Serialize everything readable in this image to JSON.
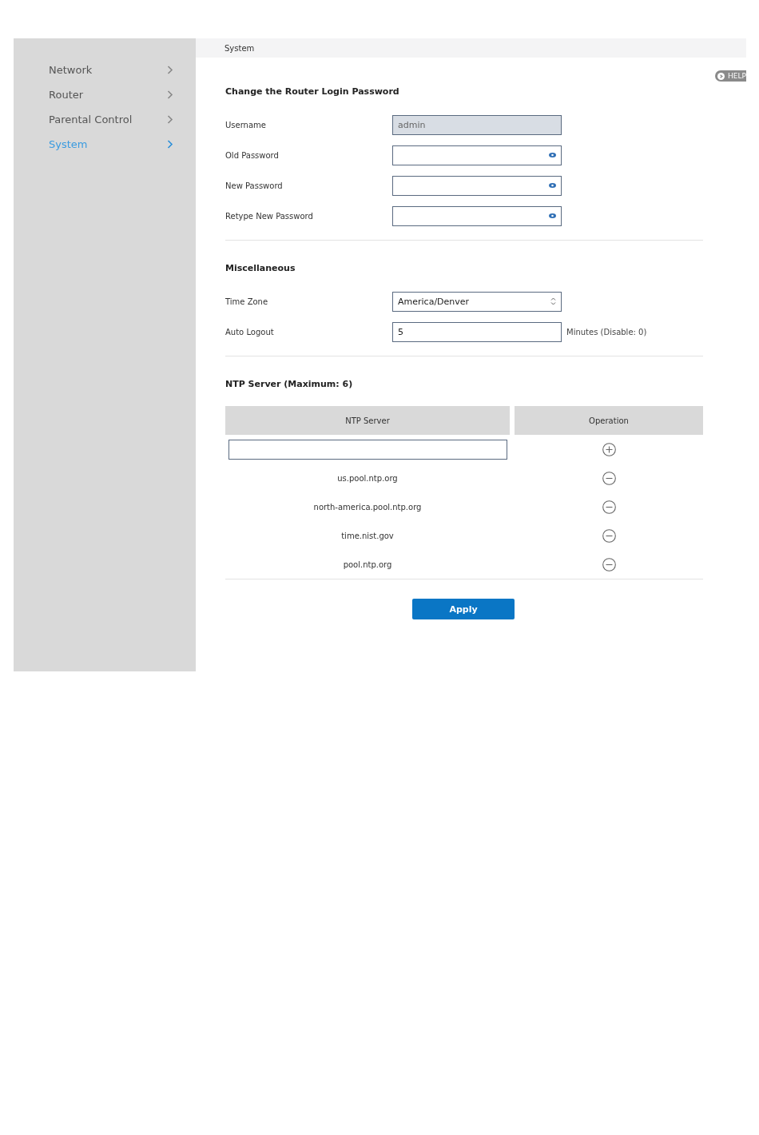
{
  "sidebar": {
    "items": [
      {
        "label": "Network",
        "selected": false
      },
      {
        "label": "Router",
        "selected": false
      },
      {
        "label": "Parental Control",
        "selected": false
      },
      {
        "label": "System",
        "selected": true
      }
    ]
  },
  "breadcrumb": "System",
  "help_button": "HELP",
  "sections": [
    {
      "title": "Change the Router Login Password",
      "fields": [
        {
          "kind": "text",
          "label": "Username",
          "value": "admin",
          "disabled": true
        },
        {
          "kind": "password",
          "label": "Old Password"
        },
        {
          "kind": "password",
          "label": "New Password"
        },
        {
          "kind": "password",
          "label": "Retype New Password"
        }
      ]
    },
    {
      "title": "Miscellaneous",
      "fields": [
        {
          "kind": "select",
          "label": "Time Zone",
          "value": "America/Denver"
        },
        {
          "kind": "text",
          "label": "Auto Logout",
          "value": "5",
          "suffix": "Minutes (Disable: 0)"
        }
      ]
    }
  ],
  "ntp": {
    "title": "NTP Server (Maximum: 6)",
    "columns": [
      "NTP Server",
      "Operation"
    ],
    "servers": [
      "us.pool.ntp.org",
      "north-america.pool.ntp.org",
      "time.nist.gov",
      "pool.ntp.org"
    ]
  },
  "apply_button": "Apply"
}
